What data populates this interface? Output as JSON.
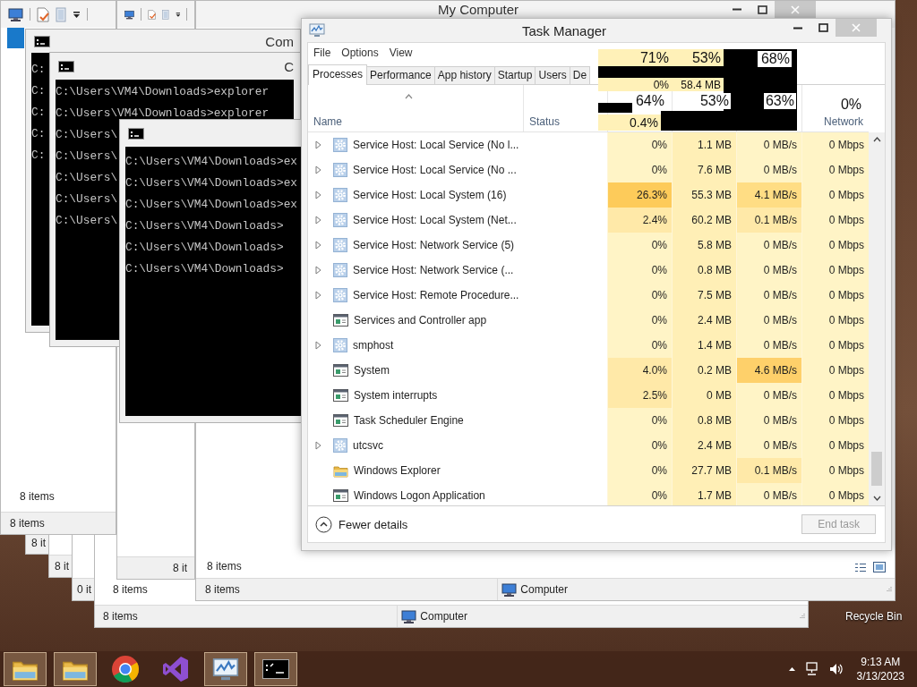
{
  "explorer_windows": [
    {
      "status": "8 it"
    },
    {
      "status": "8 it"
    },
    {
      "status": "0 it"
    },
    {
      "content_status": "8 items",
      "status": "8 items",
      "location": "Computer"
    },
    {
      "title": "My Computer",
      "content_status": "8 items",
      "status": "8 items",
      "location": "Computer"
    },
    {
      "status": "8 it"
    },
    {
      "content_status": "8 items",
      "status": "8 items"
    }
  ],
  "console_windows": [
    {
      "title": "Com",
      "lines": [
        "C:",
        "C:",
        "C:",
        "C:",
        "C:"
      ]
    },
    {
      "title": "C",
      "lines": [
        "C:\\Users\\VM4\\Downloads>explorer",
        "C:\\Users\\VM4\\Downloads>explorer",
        "C:\\Users\\",
        "C:\\Users\\",
        "C:\\Users\\",
        "C:\\Users\\",
        "C:\\Users\\"
      ]
    },
    {
      "lines": [
        "C:\\Users\\VM4\\Downloads>ex",
        "C:\\Users\\VM4\\Downloads>ex",
        "C:\\Users\\VM4\\Downloads>ex",
        "C:\\Users\\VM4\\Downloads>",
        "C:\\Users\\VM4\\Downloads>",
        "C:\\Users\\VM4\\Downloads>"
      ]
    }
  ],
  "task_manager": {
    "title": "Task Manager",
    "menu": [
      "File",
      "Options",
      "View"
    ],
    "tabs": [
      {
        "label": "Processes",
        "selected": true
      },
      {
        "label": "Performance",
        "selected": false
      },
      {
        "label": "App history",
        "selected": false
      },
      {
        "label": "Startup",
        "selected": false
      },
      {
        "label": "Users",
        "selected": false
      },
      {
        "label": "De",
        "selected": false
      }
    ],
    "glitch_readings": [
      "71%",
      "53%",
      "68%",
      "0%",
      "58.4 MB",
      "0.4%"
    ],
    "columns": [
      {
        "label": "Name",
        "sorted": true
      },
      {
        "label": "Status",
        "sorted": false
      },
      {
        "reading": "64%",
        "sorted": false
      },
      {
        "reading": "53%",
        "sorted": false
      },
      {
        "reading": "63%",
        "sorted": false
      },
      {
        "reading": "0%",
        "label": "Network",
        "sorted": false
      }
    ],
    "rows": [
      {
        "name": "Service Host: Local Service (No l...",
        "kind": "service",
        "expandable": true,
        "cpu": {
          "value": "0%"
        },
        "memory": "1.1 MB",
        "disk": {
          "value": "0 MB/s"
        },
        "network": "0 Mbps"
      },
      {
        "name": "Service Host: Local Service (No ...",
        "kind": "service",
        "expandable": true,
        "cpu": {
          "value": "0%"
        },
        "memory": "7.6 MB",
        "disk": {
          "value": "0 MB/s"
        },
        "network": "0 Mbps"
      },
      {
        "name": "Service Host: Local System (16)",
        "kind": "service",
        "expandable": true,
        "cpu": {
          "value": "26.3%",
          "color": "#fdcb5a"
        },
        "memory": "55.3 MB",
        "disk": {
          "value": "4.1 MB/s",
          "color": "#ffdd84"
        },
        "network": "0 Mbps"
      },
      {
        "name": "Service Host: Local System (Net...",
        "kind": "service",
        "expandable": true,
        "cpu": {
          "value": "2.4%",
          "color": "#ffe9a8"
        },
        "memory": "60.2 MB",
        "disk": {
          "value": "0.1 MB/s",
          "color": "#ffe9a8"
        },
        "network": "0 Mbps"
      },
      {
        "name": "Service Host: Network Service (5)",
        "kind": "service",
        "expandable": true,
        "cpu": {
          "value": "0%"
        },
        "memory": "5.8 MB",
        "disk": {
          "value": "0 MB/s"
        },
        "network": "0 Mbps"
      },
      {
        "name": "Service Host: Network Service (...",
        "kind": "service",
        "expandable": true,
        "cpu": {
          "value": "0%"
        },
        "memory": "0.8 MB",
        "disk": {
          "value": "0 MB/s"
        },
        "network": "0 Mbps"
      },
      {
        "name": "Service Host: Remote Procedure...",
        "kind": "service",
        "expandable": true,
        "cpu": {
          "value": "0%"
        },
        "memory": "7.5 MB",
        "disk": {
          "value": "0 MB/s"
        },
        "network": "0 Mbps"
      },
      {
        "name": "Services and Controller app",
        "kind": "app",
        "expandable": false,
        "cpu": {
          "value": "0%"
        },
        "memory": "2.4 MB",
        "disk": {
          "value": "0 MB/s"
        },
        "network": "0 Mbps"
      },
      {
        "name": "smphost",
        "kind": "service",
        "expandable": true,
        "cpu": {
          "value": "0%"
        },
        "memory": "1.4 MB",
        "disk": {
          "value": "0 MB/s"
        },
        "network": "0 Mbps"
      },
      {
        "name": "System",
        "kind": "app",
        "expandable": false,
        "cpu": {
          "value": "4.0%",
          "color": "#ffe9a8"
        },
        "memory": "0.2 MB",
        "disk": {
          "value": "4.6 MB/s",
          "color": "#fed06a"
        },
        "network": "0 Mbps"
      },
      {
        "name": "System interrupts",
        "kind": "app",
        "expandable": false,
        "cpu": {
          "value": "2.5%",
          "color": "#ffe9a8"
        },
        "memory": "0 MB",
        "disk": {
          "value": "0 MB/s"
        },
        "network": "0 Mbps"
      },
      {
        "name": "Task Scheduler Engine",
        "kind": "app",
        "expandable": false,
        "cpu": {
          "value": "0%"
        },
        "memory": "0.8 MB",
        "disk": {
          "value": "0 MB/s"
        },
        "network": "0 Mbps"
      },
      {
        "name": "utcsvc",
        "kind": "service",
        "expandable": true,
        "cpu": {
          "value": "0%"
        },
        "memory": "2.4 MB",
        "disk": {
          "value": "0 MB/s"
        },
        "network": "0 Mbps"
      },
      {
        "name": "Windows Explorer",
        "kind": "folder",
        "expandable": false,
        "cpu": {
          "value": "0%"
        },
        "memory": "27.7 MB",
        "disk": {
          "value": "0.1 MB/s",
          "color": "#ffe9a8"
        },
        "network": "0 Mbps"
      },
      {
        "name": "Windows Logon Application",
        "kind": "app",
        "expandable": false,
        "cpu": {
          "value": "0%"
        },
        "memory": "1.7 MB",
        "disk": {
          "value": "0 MB/s"
        },
        "network": "0 Mbps"
      }
    ],
    "fewer_details": "Fewer details",
    "end_task": {
      "label": "End task",
      "disabled": true
    }
  },
  "desktop": {
    "recycle_bin_label": "Recycle Bin"
  },
  "taskbar": {
    "buttons": [
      {
        "kind": "folder",
        "running": true
      },
      {
        "kind": "folder",
        "running": true
      },
      {
        "kind": "browser",
        "running": false
      },
      {
        "kind": "ide",
        "running": false
      },
      {
        "kind": "task_manager",
        "running": true
      },
      {
        "kind": "console",
        "running": true
      }
    ],
    "time": "9:13 AM",
    "date": "3/13/2023"
  }
}
